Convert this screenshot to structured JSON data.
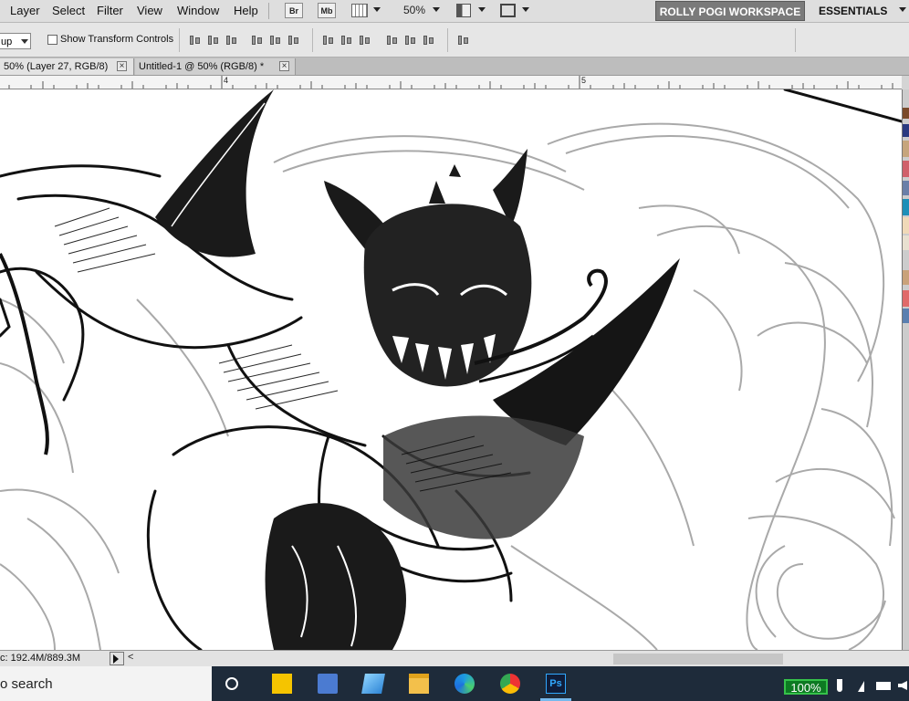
{
  "menubar": {
    "items": [
      "Layer",
      "Select",
      "Filter",
      "View",
      "Window",
      "Help"
    ],
    "bridge_label": "Br",
    "minibridge_label": "Mb",
    "zoom_level": "50%",
    "workspace_label": "ROLLY POGI WORKSPACE",
    "essentials_label": "ESSENTIALS"
  },
  "options": {
    "auto_select_value": "up",
    "show_transform_label": "Show Transform Controls",
    "show_transform_checked": false
  },
  "tabs": [
    {
      "label": "50% (Layer 27, RGB/8)",
      "active": true
    },
    {
      "label": "Untitled-1 @ 50% (RGB/8) *",
      "active": false
    }
  ],
  "ruler": {
    "marks": [
      "4",
      "5"
    ]
  },
  "status": {
    "doc_size": "c: 192.4M/889.3M"
  },
  "swatches": [
    "#7a4a2a",
    "#2a3a80",
    "#c6a57c",
    "#d0606a",
    "#6a7fa8",
    "#1e8fb8",
    "#f0d9b8",
    "#e8e0d0",
    "#c9a27a",
    "#e06a6a",
    "#5a7fb0"
  ],
  "taskbar": {
    "search_text": "o search",
    "battery_percent": "100%",
    "ps_label": "Ps"
  }
}
